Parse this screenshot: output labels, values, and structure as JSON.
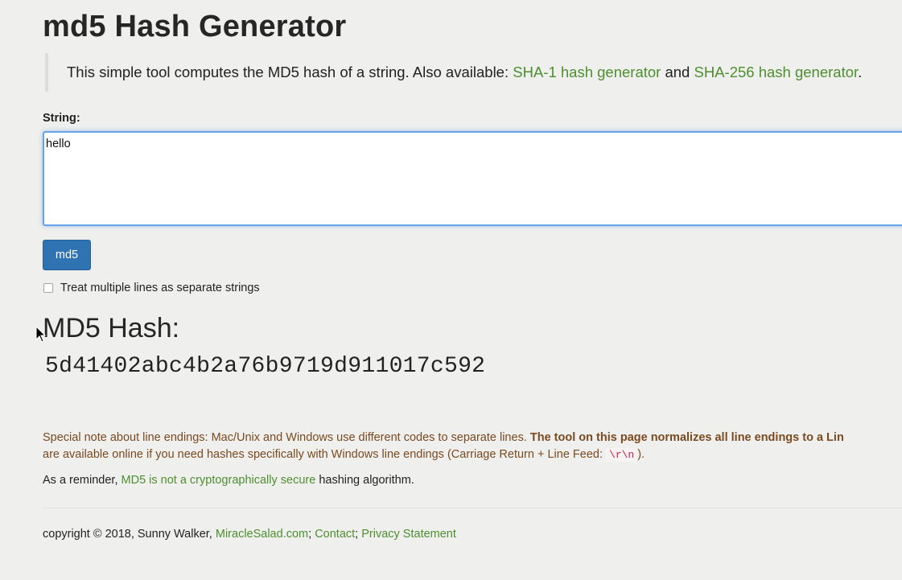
{
  "title": "md5 Hash Generator",
  "intro": {
    "text": "This simple tool computes the MD5 hash of a string. Also available: ",
    "link1": "SHA-1 hash generator",
    "and": " and ",
    "link2": "SHA-256 hash generator",
    "end": "."
  },
  "form": {
    "string_label": "String:",
    "input_value": "hello",
    "submit_label": "md5",
    "checkbox_label": "Treat multiple lines as separate strings",
    "checkbox_checked": false
  },
  "result": {
    "heading": "MD5 Hash:",
    "hash": "5d41402abc4b2a76b9719d911017c592"
  },
  "note": {
    "line1_plain": "Special note about line endings: Mac/Unix and Windows use different codes to separate lines. ",
    "line1_bold": "The tool on this page normalizes all line endings to a Lin",
    "line2": "are available online if you need hashes specifically with Windows line endings (Carriage Return + Line Feed: ",
    "code": "\\r\\n",
    "line2_end": ")."
  },
  "reminder": {
    "prefix": "As a reminder, ",
    "link": "MD5 is not a cryptographically secure",
    "suffix": " hashing algorithm."
  },
  "footer": {
    "copyright": "copyright © 2018, Sunny Walker, ",
    "link1": "MiracleSalad.com",
    "sep1": "; ",
    "link2": "Contact",
    "sep2": "; ",
    "link3": "Privacy Statement"
  },
  "colors": {
    "link": "#4d8f2f",
    "button": "#2f73b3",
    "focus": "#66a3e8",
    "note": "#7a4a20"
  }
}
